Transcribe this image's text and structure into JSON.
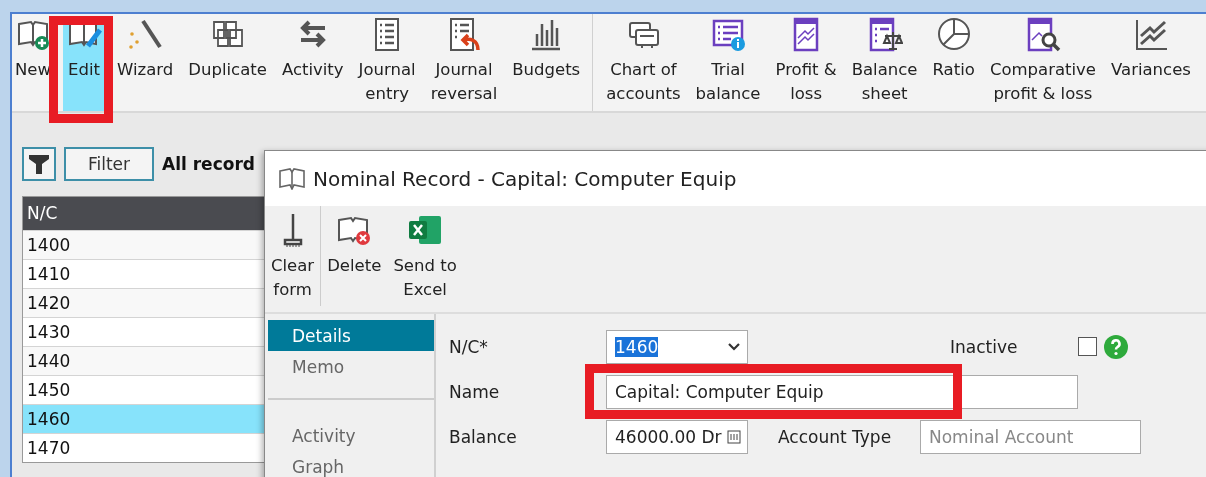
{
  "toolbar": {
    "groups": [
      [
        {
          "label": "New",
          "selected": false
        },
        {
          "label": "Edit",
          "selected": true,
          "highlighted": true
        },
        {
          "label": "Wizard",
          "selected": false
        },
        {
          "label": "Duplicate",
          "selected": false
        },
        {
          "label": "Activity",
          "selected": false
        },
        {
          "label": "Journal\nentry",
          "selected": false
        },
        {
          "label": "Journal\nreversal",
          "selected": false
        },
        {
          "label": "Budgets",
          "selected": false
        }
      ],
      [
        {
          "label": "Chart of\naccounts",
          "selected": false
        },
        {
          "label": "Trial\nbalance",
          "selected": false
        },
        {
          "label": "Profit &\nloss",
          "selected": false
        },
        {
          "label": "Balance\nsheet",
          "selected": false
        },
        {
          "label": "Ratio",
          "selected": false
        },
        {
          "label": "Comparative\nprofit & loss",
          "selected": false
        },
        {
          "label": "Variances",
          "selected": false
        }
      ]
    ]
  },
  "filter_bar": {
    "button": "Filter",
    "caption": "All record"
  },
  "table": {
    "columns": [
      "N/C"
    ],
    "rows": [
      {
        "nc": "1400",
        "selected": false
      },
      {
        "nc": "1410",
        "selected": false
      },
      {
        "nc": "1420",
        "selected": false
      },
      {
        "nc": "1430",
        "selected": false
      },
      {
        "nc": "1440",
        "selected": false
      },
      {
        "nc": "1450",
        "selected": false
      },
      {
        "nc": "1460",
        "selected": true
      },
      {
        "nc": "1470",
        "selected": false
      }
    ]
  },
  "dialog": {
    "title": "Nominal Record - Capital: Computer Equip",
    "toolbar": [
      "Clear\nform",
      "Delete",
      "Send to\nExcel"
    ],
    "nav": [
      [
        {
          "label": "Details",
          "selected": true
        },
        {
          "label": "Memo",
          "selected": false
        }
      ],
      [
        {
          "label": "Activity",
          "selected": false
        },
        {
          "label": "Graph",
          "selected": false
        }
      ]
    ],
    "form": {
      "nc_label": "N/C*",
      "nc_value": "1460",
      "inactive_label": "Inactive",
      "inactive_checked": false,
      "name_label": "Name",
      "name_value": "Capital: Computer Equip",
      "name_highlighted": true,
      "balance_label": "Balance",
      "balance_value": "46000.00 Dr",
      "account_type_label": "Account Type",
      "account_type_value": "Nominal Account"
    }
  }
}
